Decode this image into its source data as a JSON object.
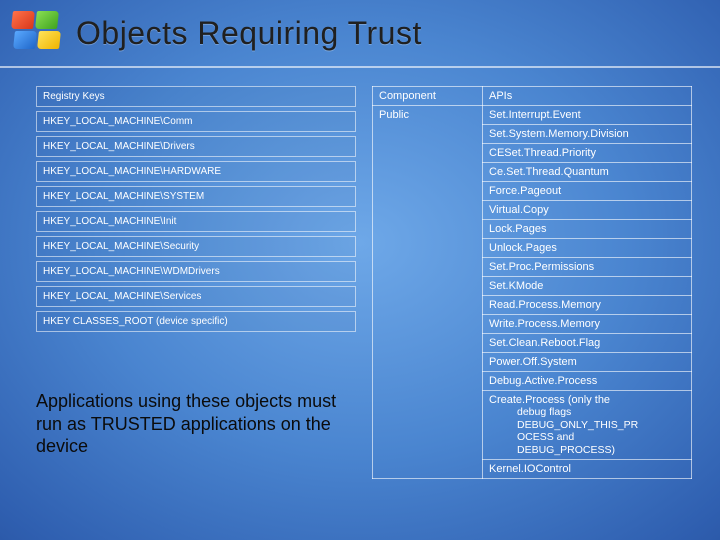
{
  "title": "Objects Requiring Trust",
  "registry_header": "Registry Keys",
  "registry_keys": [
    "HKEY_LOCAL_MACHINE\\Comm",
    "HKEY_LOCAL_MACHINE\\Drivers",
    "HKEY_LOCAL_MACHINE\\HARDWARE",
    "HKEY_LOCAL_MACHINE\\SYSTEM",
    "HKEY_LOCAL_MACHINE\\Init",
    "HKEY_LOCAL_MACHINE\\Security",
    "HKEY_LOCAL_MACHINE\\WDMDrivers",
    "HKEY_LOCAL_MACHINE\\Services",
    "HKEY CLASSES_ROOT (device specific)"
  ],
  "note_text": "Applications using these objects must run as TRUSTED applications on the device",
  "table": {
    "headers": {
      "component": "Component",
      "apis": "APIs"
    },
    "component_value": "Public",
    "apis": [
      "Set.Interrupt.Event",
      "Set.System.Memory.Division",
      "CESet.Thread.Priority",
      "Ce.Set.Thread.Quantum",
      "Force.Pageout",
      "Virtual.Copy",
      "Lock.Pages",
      "Unlock.Pages",
      "Set.Proc.Permissions",
      "Set.KMode",
      "Read.Process.Memory",
      "Write.Process.Memory",
      "Set.Clean.Reboot.Flag",
      "Power.Off.System",
      "Debug.Active.Process",
      "Create.Process (only the",
      "Kernel.IOControl"
    ],
    "api15_sub": [
      "debug flags",
      "DEBUG_ONLY_THIS_PR",
      "OCESS and",
      "DEBUG_PROCESS)"
    ]
  }
}
